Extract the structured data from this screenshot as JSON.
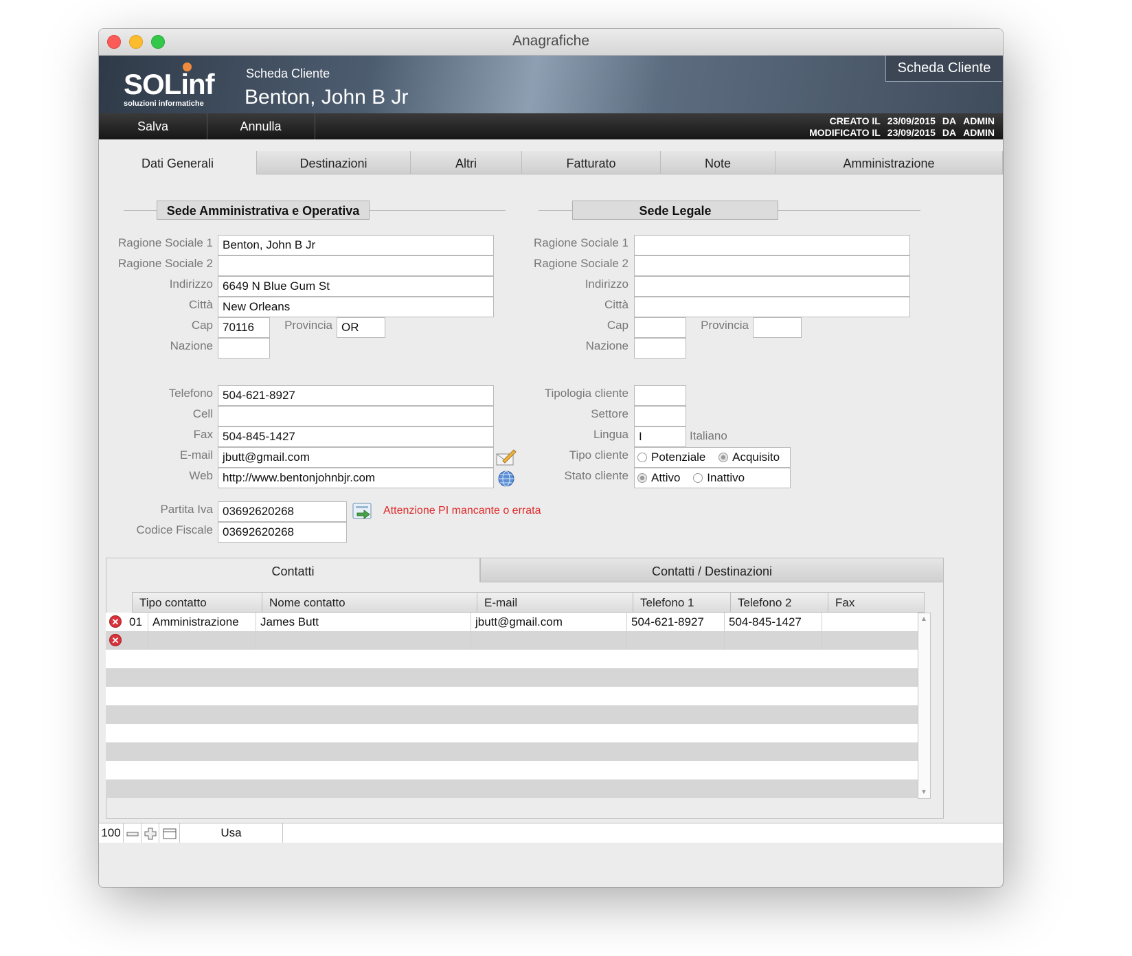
{
  "window": {
    "title": "Anagrafiche"
  },
  "banner": {
    "logo_text": "SOLinf",
    "logo_sub": "soluzioni informatiche",
    "subtitle": "Scheda Cliente",
    "customer_name": "Benton, John B Jr",
    "badge": "Scheda Cliente"
  },
  "toolbar": {
    "save_label": "Salva",
    "cancel_label": "Annulla",
    "created_label": "CREATO IL",
    "created_date": "23/09/2015",
    "created_by_label": "DA",
    "created_by": "ADMIN",
    "modified_label": "MODIFICATO IL",
    "modified_date": "23/09/2015",
    "modified_by_label": "DA",
    "modified_by": "ADMIN"
  },
  "tabs": [
    "Dati Generali",
    "Destinazioni",
    "Altri",
    "Fatturato",
    "Note",
    "Amministrazione"
  ],
  "sede_amm": {
    "title": "Sede Amministrativa e Operativa",
    "ragione1_label": "Ragione Sociale 1",
    "ragione1": "Benton, John B Jr",
    "ragione2_label": "Ragione Sociale 2",
    "ragione2": "",
    "indirizzo_label": "Indirizzo",
    "indirizzo": "6649 N Blue Gum St",
    "citta_label": "Città",
    "citta": "New Orleans",
    "cap_label": "Cap",
    "cap": "70116",
    "provincia_label": "Provincia",
    "provincia": "OR",
    "nazione_label": "Nazione",
    "nazione": ""
  },
  "sede_legale": {
    "title": "Sede Legale",
    "ragione1_label": "Ragione Sociale 1",
    "ragione1": "",
    "ragione2_label": "Ragione Sociale 2",
    "ragione2": "",
    "indirizzo_label": "Indirizzo",
    "indirizzo": "",
    "citta_label": "Città",
    "citta": "",
    "cap_label": "Cap",
    "cap": "",
    "provincia_label": "Provincia",
    "provincia": "",
    "nazione_label": "Nazione",
    "nazione": ""
  },
  "contatti_fields": {
    "telefono_label": "Telefono",
    "telefono": "504-621-8927",
    "cell_label": "Cell",
    "cell": "",
    "fax_label": "Fax",
    "fax": "504-845-1427",
    "email_label": "E-mail",
    "email": "jbutt@gmail.com",
    "web_label": "Web",
    "web": "http://www.bentonjohnbjr.com"
  },
  "classificazione": {
    "tipologia_label": "Tipologia cliente",
    "tipologia": "",
    "settore_label": "Settore",
    "settore": "",
    "lingua_label": "Lingua",
    "lingua": "I",
    "lingua_name": "Italiano",
    "tipo_label": "Tipo cliente",
    "tipo_opt1": "Potenziale",
    "tipo_opt2": "Acquisito",
    "tipo_selected": "Acquisito",
    "stato_label": "Stato cliente",
    "stato_opt1": "Attivo",
    "stato_opt2": "Inattivo",
    "stato_selected": "Attivo"
  },
  "fiscale": {
    "piva_label": "Partita Iva",
    "piva": "03692620268",
    "cf_label": "Codice Fiscale",
    "cf": "03692620268",
    "warning": "Attenzione PI mancante o errata"
  },
  "contacts_panel": {
    "tab1": "Contatti",
    "tab2": "Contatti / Destinazioni",
    "columns": [
      "Tipo contatto",
      "Nome contatto",
      "E-mail",
      "Telefono 1",
      "Telefono 2",
      "Fax"
    ],
    "rows": [
      {
        "code": "01",
        "tipo": "Amministrazione",
        "nome": "James Butt",
        "email": "jbutt@gmail.com",
        "tel1": "504-621-8927",
        "tel2": "504-845-1427",
        "fax": ""
      }
    ]
  },
  "statusbar": {
    "zoom": "100",
    "locale": "Usa"
  },
  "icons": [
    "close-icon",
    "minimize-icon",
    "zoom-icon",
    "compose-email-icon",
    "globe-icon",
    "vat-check-icon",
    "delete-row-icon",
    "zoom-out-icon",
    "zoom-in-icon",
    "layout-icon"
  ],
  "colors": {
    "accent_orange": "#f08a3c",
    "warning_red": "#e02a2a",
    "delete_red": "#d8323a"
  }
}
